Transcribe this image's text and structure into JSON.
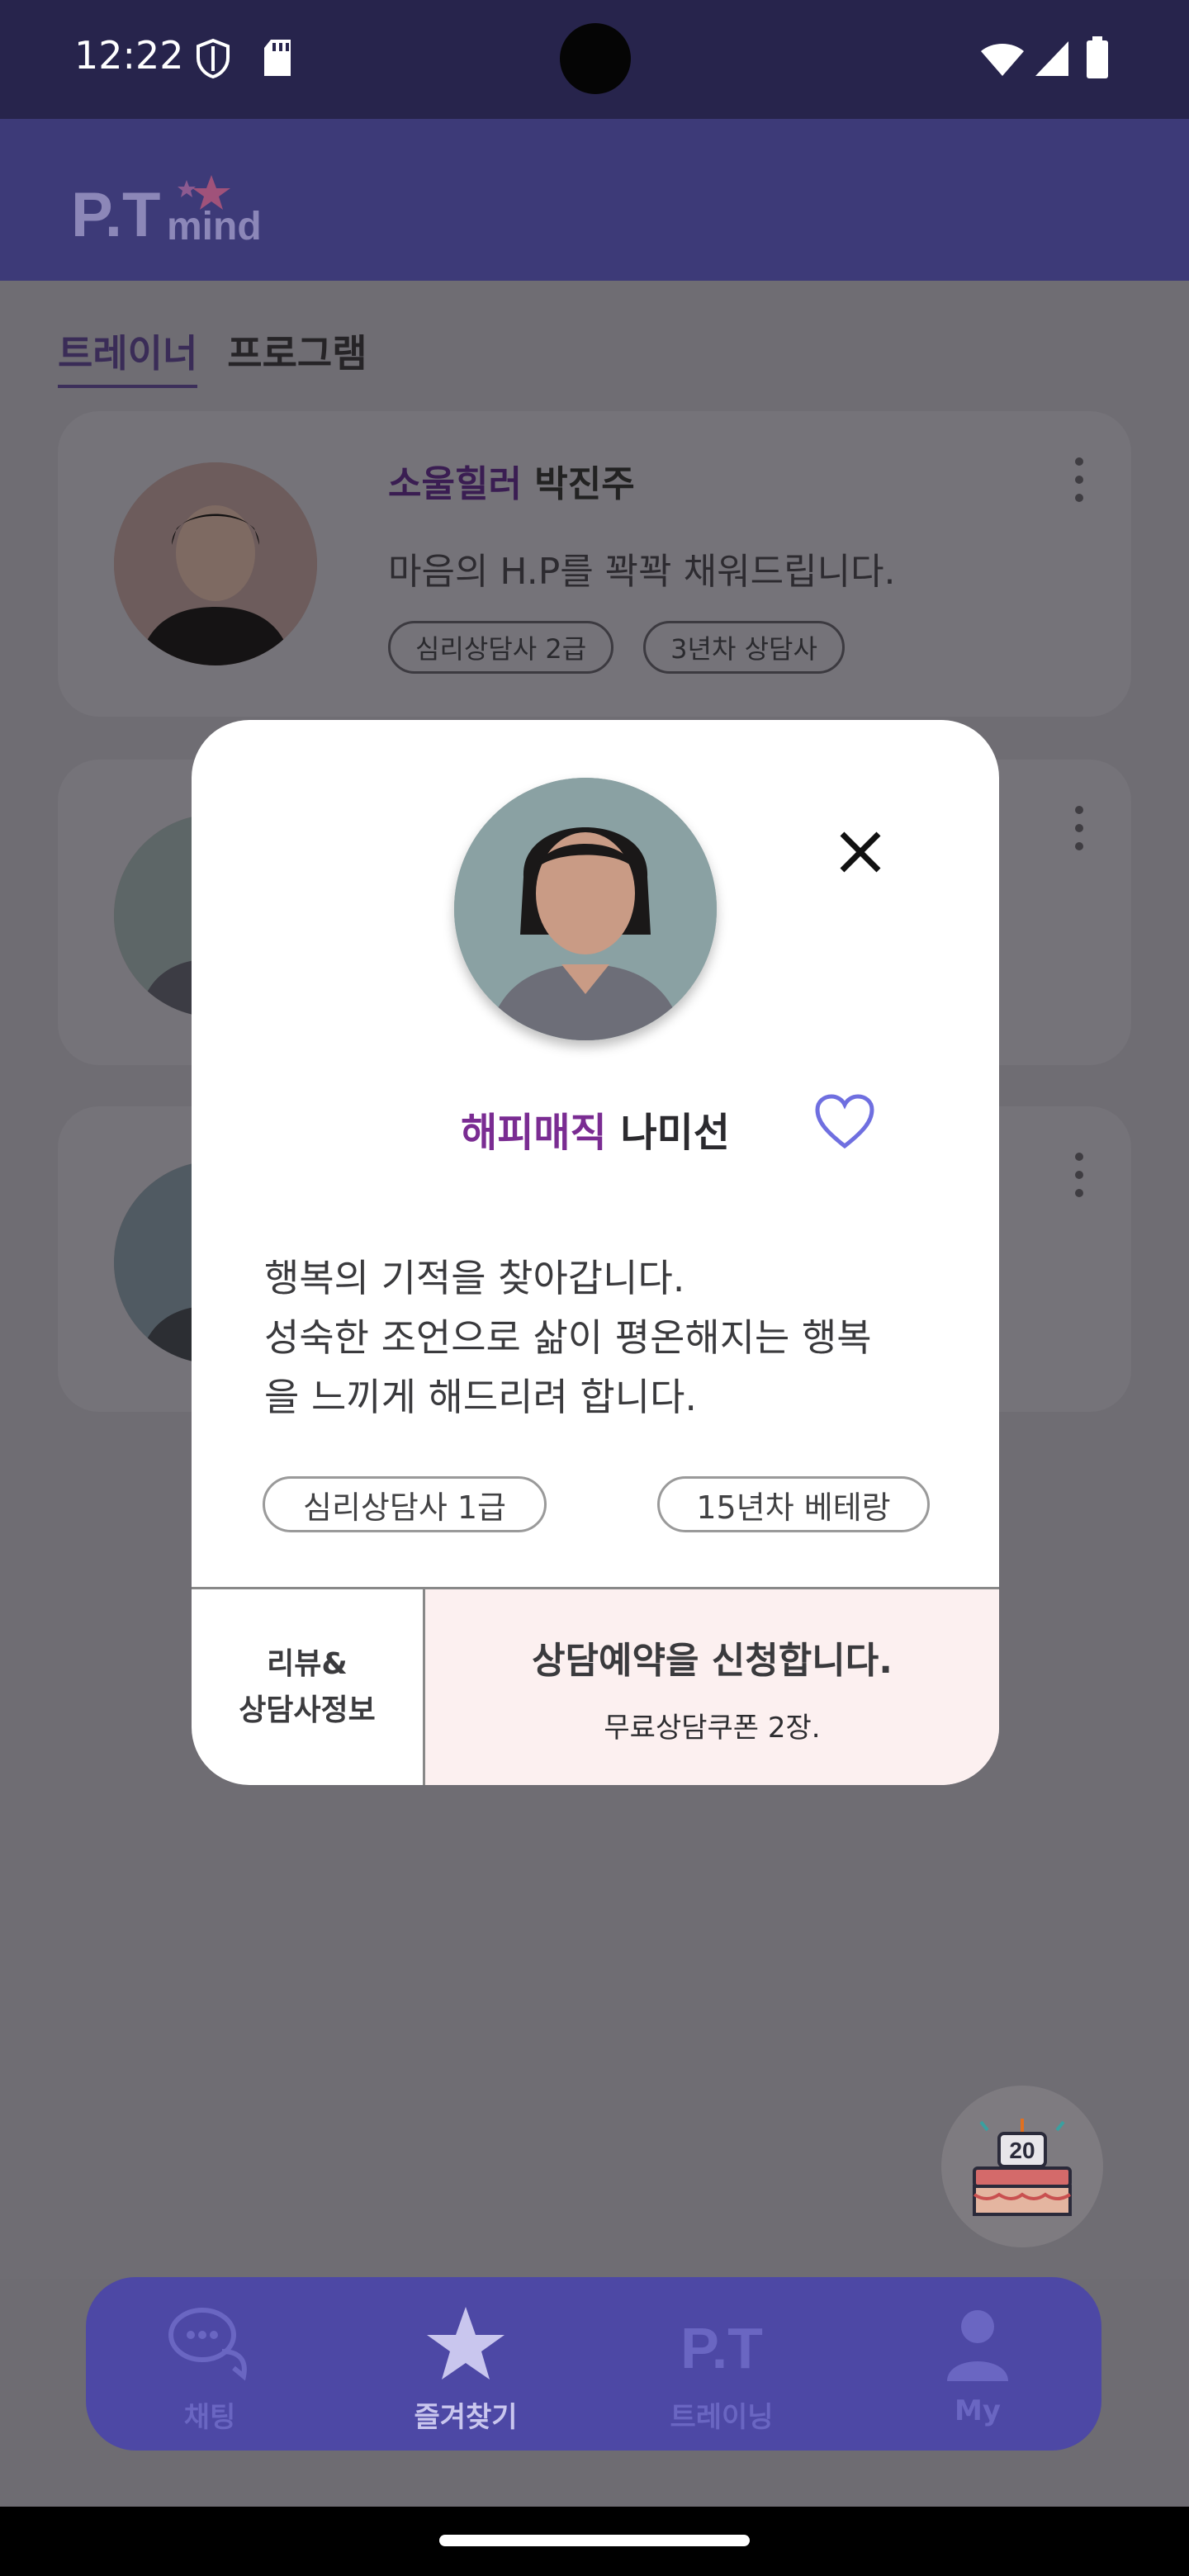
{
  "status_bar": {
    "time": "12:22"
  },
  "header": {
    "logo_text": "P.T",
    "logo_sub": "mind"
  },
  "tabs": [
    {
      "label": "트레이너",
      "active": true
    },
    {
      "label": "프로그램",
      "active": false
    }
  ],
  "cards": [
    {
      "nickname": "소울힐러",
      "name": "박진주",
      "description": "마음의 H.P를 꽉꽉 채워드립니다.",
      "tags": [
        "심리상담사 2급",
        "3년차 상담사"
      ]
    }
  ],
  "modal": {
    "nickname": "해피매직",
    "name": "나미선",
    "description_lines": [
      "행복의 기적을 찾아갑니다.",
      "성숙한 조언으로 삶이 평온해지는 행복",
      "을 느끼게 해드리려 합니다."
    ],
    "tags": [
      "심리상담사 1급",
      "15년차 베테랑"
    ],
    "review_button": {
      "line1": "리뷰&",
      "line2": "상담사정보"
    },
    "reserve_button": {
      "title": "상담예약을 신청합니다.",
      "subtitle": "무료상담쿠폰 2장."
    },
    "favorite": false
  },
  "fab": {
    "badge_number": "20"
  },
  "bottom_nav": [
    {
      "label": "채팅",
      "icon": "chat-icon",
      "active": false
    },
    {
      "label": "즐겨찾기",
      "icon": "star-icon",
      "active": true
    },
    {
      "label": "트레이닝",
      "icon": "pt-icon",
      "icon_text": "P.T",
      "active": false
    },
    {
      "label": "My",
      "icon": "person-icon",
      "active": false
    }
  ],
  "colors": {
    "accent": "#7a2c92",
    "header": "#3d3a78",
    "nav": "#4d48a5",
    "reserve_bg": "#fcf0f0"
  }
}
